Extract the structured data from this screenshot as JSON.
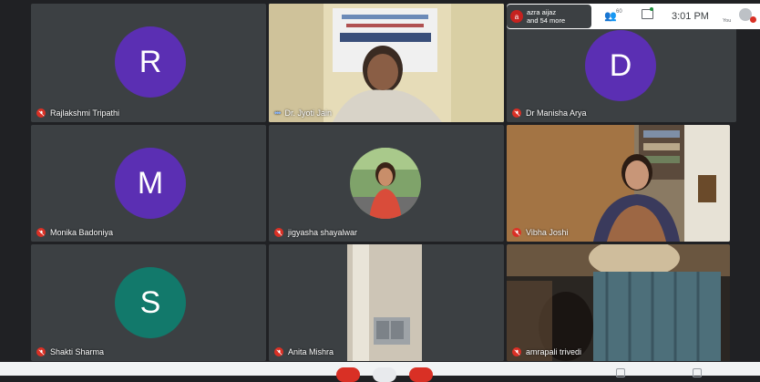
{
  "participants_tile": {
    "avatar_letter": "a",
    "line1": "azra aijaz",
    "line2": "and 54 more"
  },
  "toolbar": {
    "people_count": "60",
    "time": "3:01 PM",
    "you_label": "You"
  },
  "tiles": [
    {
      "name": "Rajlakshmi Tripathi",
      "letter": "R",
      "color": "#5b2fb3"
    },
    {
      "name": "Dr. Jyoti Jain",
      "video": true
    },
    {
      "name": "Dr Manisha Arya",
      "letter": "D",
      "color": "#5b2fb3"
    },
    {
      "name": "Monika Badoniya",
      "letter": "M",
      "color": "#5b2fb3"
    },
    {
      "name": "jigyasha shayalwar",
      "photo": true
    },
    {
      "name": "Vibha Joshi",
      "video": true
    },
    {
      "name": "Shakti Sharma",
      "letter": "S",
      "color": "#12796b"
    },
    {
      "name": "Anita Mishra",
      "video": true
    },
    {
      "name": "amrapali trivedi",
      "video": true
    }
  ]
}
